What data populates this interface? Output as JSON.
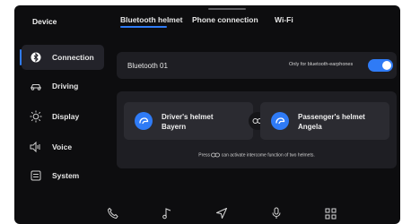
{
  "sidebar": {
    "title": "Device",
    "items": [
      {
        "label": "Connection",
        "icon": "bluetooth-icon",
        "active": true
      },
      {
        "label": "Driving",
        "icon": "car-icon",
        "active": false
      },
      {
        "label": "Display",
        "icon": "brightness-icon",
        "active": false
      },
      {
        "label": "Voice",
        "icon": "speaker-icon",
        "active": false
      },
      {
        "label": "System",
        "icon": "system-icon",
        "active": false
      }
    ]
  },
  "tabs": [
    {
      "label": "Bluetooth helmet",
      "active": true
    },
    {
      "label": "Phone connection",
      "active": false
    },
    {
      "label": "Wi-Fi",
      "active": false
    }
  ],
  "bluetooth": {
    "name": "Bluetooth 01",
    "toggle_label": "Only for bluetooth-earphones",
    "toggle_on": true
  },
  "helmets": {
    "left": {
      "title": "Driver's helmet",
      "name": "Bayern"
    },
    "right": {
      "title": "Passenger's helmet",
      "name": "Angela"
    },
    "hint_prefix": "Press",
    "hint_suffix": "can activate intercome function of two helmets."
  },
  "bottombar": {
    "icons": [
      "phone-icon",
      "music-note-icon",
      "navigation-icon",
      "microphone-icon",
      "apps-grid-icon"
    ]
  },
  "colors": {
    "accent": "#2f7bf6",
    "background": "#0d0d0f",
    "card": "#1e1e23",
    "card_inner": "#2b2b31"
  }
}
